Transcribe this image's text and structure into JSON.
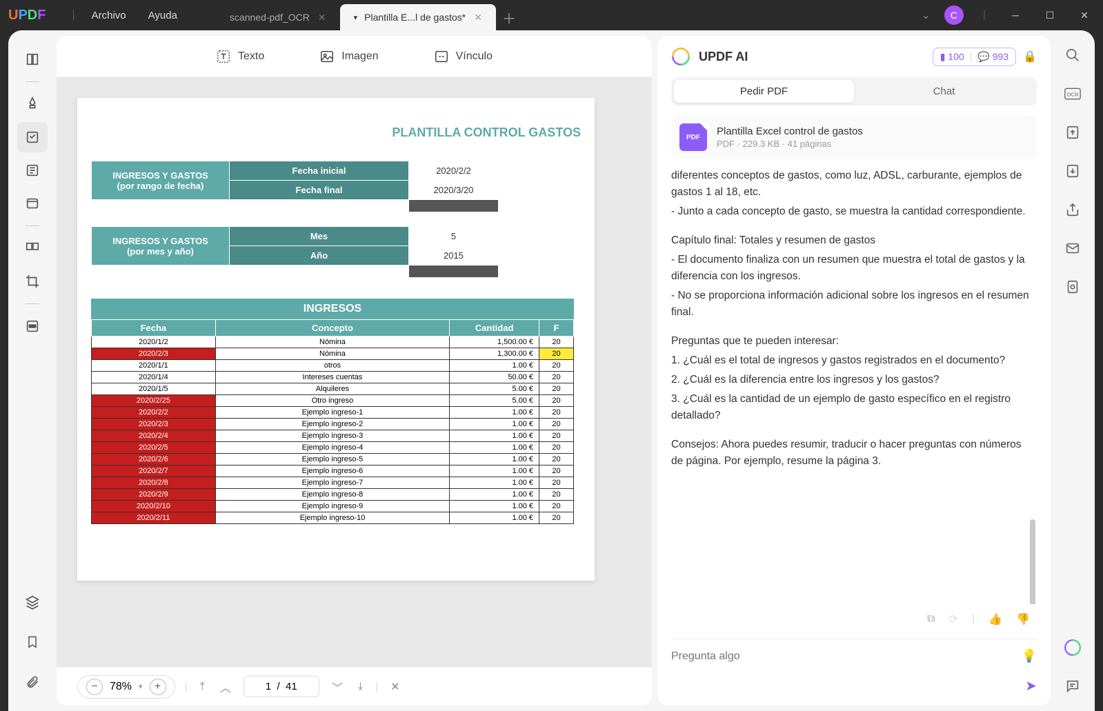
{
  "titlebar": {
    "logo": "UPDF",
    "menu": {
      "archivo": "Archivo",
      "ayuda": "Ayuda"
    },
    "tabs": [
      {
        "label": "scanned-pdf_OCR",
        "active": false
      },
      {
        "label": "Plantilla E...l de gastos*",
        "active": true
      }
    ],
    "avatar_letter": "C"
  },
  "edit_toolbar": {
    "texto": "Texto",
    "imagen": "Imagen",
    "vinculo": "Vínculo"
  },
  "document": {
    "title": "PLANTILLA CONTROL GASTOS",
    "block1": {
      "header": "INGRESOS Y GASTOS (por rango de fecha)",
      "rows": [
        {
          "label": "Fecha inicial",
          "value": "2020/2/2"
        },
        {
          "label": "Fecha final",
          "value": "2020/3/20"
        }
      ]
    },
    "block2": {
      "header": "INGRESOS Y GASTOS (por mes y año)",
      "rows": [
        {
          "label": "Mes",
          "value": "5"
        },
        {
          "label": "Año",
          "value": "2015"
        }
      ]
    },
    "ingresos": {
      "title": "INGRESOS",
      "cols": [
        "Fecha",
        "Concepto",
        "Cantidad",
        "F"
      ],
      "rows": [
        {
          "fecha": "2020/1/2",
          "concepto": "Nómina",
          "cantidad": "1,500.00 €",
          "red": false,
          "f": "20"
        },
        {
          "fecha": "2020/2/3",
          "concepto": "Nómina",
          "cantidad": "1,300.00 €",
          "red": true,
          "f": "20",
          "yellow": true
        },
        {
          "fecha": "2020/1/1",
          "concepto": "otros",
          "cantidad": "1.00 €",
          "red": false,
          "f": "20"
        },
        {
          "fecha": "2020/1/4",
          "concepto": "Intereses cuentas",
          "cantidad": "50.00 €",
          "red": false,
          "f": "20"
        },
        {
          "fecha": "2020/1/5",
          "concepto": "Alquileres",
          "cantidad": "5.00 €",
          "red": false,
          "f": "20"
        },
        {
          "fecha": "2020/2/25",
          "concepto": "Otro ingreso",
          "cantidad": "5.00 €",
          "red": true,
          "f": "20"
        },
        {
          "fecha": "2020/2/2",
          "concepto": "Ejemplo ingreso-1",
          "cantidad": "1.00 €",
          "red": true,
          "f": "20"
        },
        {
          "fecha": "2020/2/3",
          "concepto": "Ejemplo ingreso-2",
          "cantidad": "1.00 €",
          "red": true,
          "f": "20"
        },
        {
          "fecha": "2020/2/4",
          "concepto": "Ejemplo ingreso-3",
          "cantidad": "1.00 €",
          "red": true,
          "f": "20"
        },
        {
          "fecha": "2020/2/5",
          "concepto": "Ejemplo ingreso-4",
          "cantidad": "1.00 €",
          "red": true,
          "f": "20"
        },
        {
          "fecha": "2020/2/6",
          "concepto": "Ejemplo ingreso-5",
          "cantidad": "1.00 €",
          "red": true,
          "f": "20"
        },
        {
          "fecha": "2020/2/7",
          "concepto": "Ejemplo ingreso-6",
          "cantidad": "1.00 €",
          "red": true,
          "f": "20"
        },
        {
          "fecha": "2020/2/8",
          "concepto": "Ejemplo ingreso-7",
          "cantidad": "1.00 €",
          "red": true,
          "f": "20"
        },
        {
          "fecha": "2020/2/9",
          "concepto": "Ejemplo ingreso-8",
          "cantidad": "1.00 €",
          "red": true,
          "f": "20"
        },
        {
          "fecha": "2020/2/10",
          "concepto": "Ejemplo ingreso-9",
          "cantidad": "1.00 €",
          "red": true,
          "f": "20"
        },
        {
          "fecha": "2020/2/11",
          "concepto": "Ejemplo ingreso-10",
          "cantidad": "1.00 €",
          "red": true,
          "f": "20"
        }
      ]
    }
  },
  "bottom_bar": {
    "zoom": "78%",
    "page_current": "1",
    "page_total": "41",
    "page_display": "1  /  41"
  },
  "ai_panel": {
    "title": "UPDF AI",
    "badge1": "100",
    "badge2": "993",
    "tab_pedir": "Pedir PDF",
    "tab_chat": "Chat",
    "file": {
      "name": "Plantilla Excel control de gastos",
      "meta": "PDF · 229.3 KB · 41 páginas",
      "icon_label": "PDF"
    },
    "content": {
      "l1": "diferentes conceptos de gastos, como luz, ADSL, carburante, ejemplos de gastos 1 al 18, etc.",
      "l2": "- Junto a cada concepto de gasto, se muestra la cantidad correspondiente.",
      "l3": "Capítulo final: Totales y resumen de gastos",
      "l4": "- El documento finaliza con un resumen que muestra el total de gastos y la diferencia con los ingresos.",
      "l5": "- No se proporciona información adicional sobre los ingresos en el resumen final.",
      "l6": "Preguntas que te pueden interesar:",
      "l7": "1. ¿Cuál es el total de ingresos y gastos registrados en el documento?",
      "l8": "2. ¿Cuál es la diferencia entre los ingresos y los gastos?",
      "l9": "3. ¿Cuál es la cantidad de un ejemplo de gasto específico en el registro detallado?",
      "l10": "Consejos: Ahora puedes resumir, traducir o hacer preguntas con números de página. Por ejemplo, resume la página 3."
    },
    "input_placeholder": "Pregunta algo"
  }
}
